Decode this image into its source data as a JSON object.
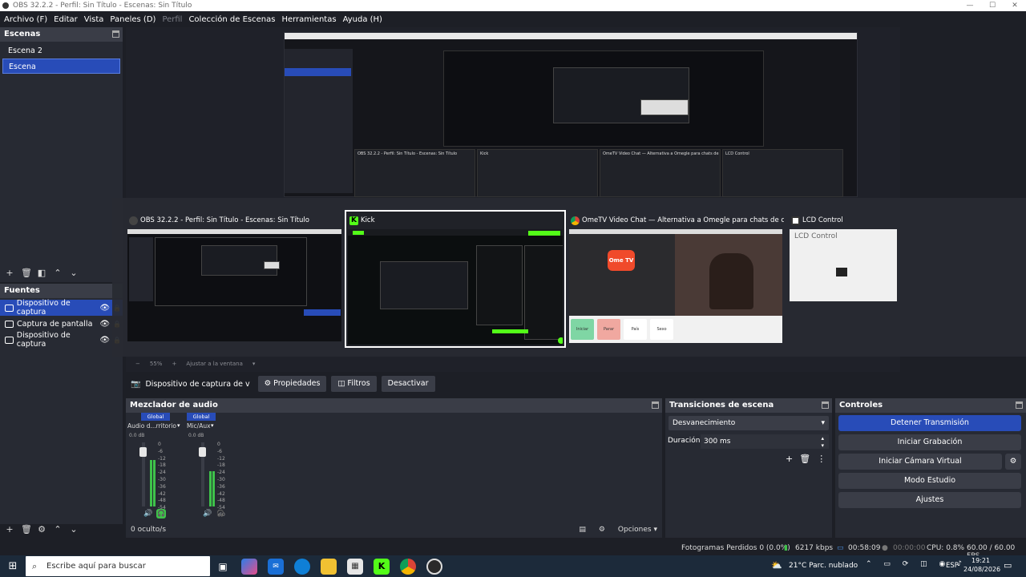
{
  "window": {
    "title": "OBS 32.2.2 - Perfil: Sin Título - Escenas: Sin Título"
  },
  "menu": {
    "items": [
      {
        "label": "Archivo (F)",
        "dim": false
      },
      {
        "label": "Editar",
        "dim": false
      },
      {
        "label": "Vista",
        "dim": false
      },
      {
        "label": "Paneles (D)",
        "dim": false
      },
      {
        "label": "Perfil",
        "dim": true
      },
      {
        "label": "Colección de Escenas",
        "dim": false
      },
      {
        "label": "Herramientas",
        "dim": false
      },
      {
        "label": "Ayuda (H)",
        "dim": false
      }
    ]
  },
  "scenes": {
    "title": "Escenas",
    "items": [
      {
        "label": "Escena 2",
        "selected": false
      },
      {
        "label": "Escena",
        "selected": true
      }
    ]
  },
  "sources": {
    "title": "Fuentes",
    "items": [
      {
        "label": "Dispositivo de captura",
        "selected": true
      },
      {
        "label": "Captura de pantalla",
        "selected": false
      },
      {
        "label": "Dispositivo de captura",
        "selected": false
      }
    ]
  },
  "switcher": {
    "back_windows": [
      {
        "title": "OBS 32.2.2 - Perfil: Sin Título - Escenas: Sin Título"
      },
      {
        "title": "Kick"
      },
      {
        "title": "OmeTV Video Chat — Alternativa a Omegle para chats de cám..."
      },
      {
        "title": "LCD Control"
      }
    ],
    "windows": [
      {
        "title": "OBS 32.2.2 - Perfil: Sin Título - Escenas: Sin Título",
        "icon": "obs-icon"
      },
      {
        "title": "Kick",
        "icon": "kick-icon"
      },
      {
        "title": "OmeTV Video Chat — Alternativa a Omegle para chats de cám...",
        "icon": "chrome-icon"
      },
      {
        "title": "LCD Control",
        "icon": "lcd-icon"
      }
    ],
    "lcd_text": "LCD Control",
    "ome_logo": "Ome TV",
    "ome_buttons": [
      "Iniciar",
      "Parar",
      "País",
      "Sexo"
    ]
  },
  "preview_footer": {
    "zoom": "55%",
    "fit": "Ajustar a la ventana"
  },
  "source_toolbar": {
    "source_name": "Dispositivo de captura de v",
    "properties": "Propiedades",
    "filters": "Filtros",
    "deactivate": "Desactivar"
  },
  "mixer": {
    "title": "Mezclador de audio",
    "channels": [
      {
        "badge": "Global",
        "name": "Audio d...rritorio",
        "db": "0.0 dB",
        "level": 0.72
      },
      {
        "badge": "Global",
        "name": "Mic/Aux",
        "db": "0.0 dB",
        "level": 0.55
      }
    ],
    "scale": [
      "0",
      "-6",
      "-12",
      "-18",
      "-24",
      "-30",
      "-36",
      "-42",
      "-48",
      "-54",
      "-60"
    ],
    "hidden": "0 oculto/s"
  },
  "transitions": {
    "title": "Transiciones de escena",
    "selected": "Desvanecimiento",
    "duration_label": "Duración",
    "duration_value": "300 ms"
  },
  "controls": {
    "title": "Controles",
    "stop_stream": "Detener Transmisión",
    "start_recording": "Iniciar Grabación",
    "start_virtual_cam": "Iniciar Cámara Virtual",
    "studio_mode": "Modo Estudio",
    "settings": "Ajustes"
  },
  "bottom_toolbar": {
    "options": "Opciones"
  },
  "status": {
    "dropped": "Fotogramas Perdidos 0 (0.0%)",
    "bitrate": "6217 kbps",
    "stream_time": "00:58:09",
    "rec_time": "00:00:00",
    "cpu": "CPU: 0.8%",
    "fps": "60.00 / 60.00 FPS"
  },
  "taskbar": {
    "search_placeholder": "Escribe aquí para buscar",
    "weather": "21°C  Parc. nublado",
    "lang": "ESP",
    "time": "19:21",
    "date": "24/08/2026"
  },
  "colors": {
    "accent": "#284cb8",
    "kick_green": "#53fc18",
    "panel": "#272a33"
  }
}
